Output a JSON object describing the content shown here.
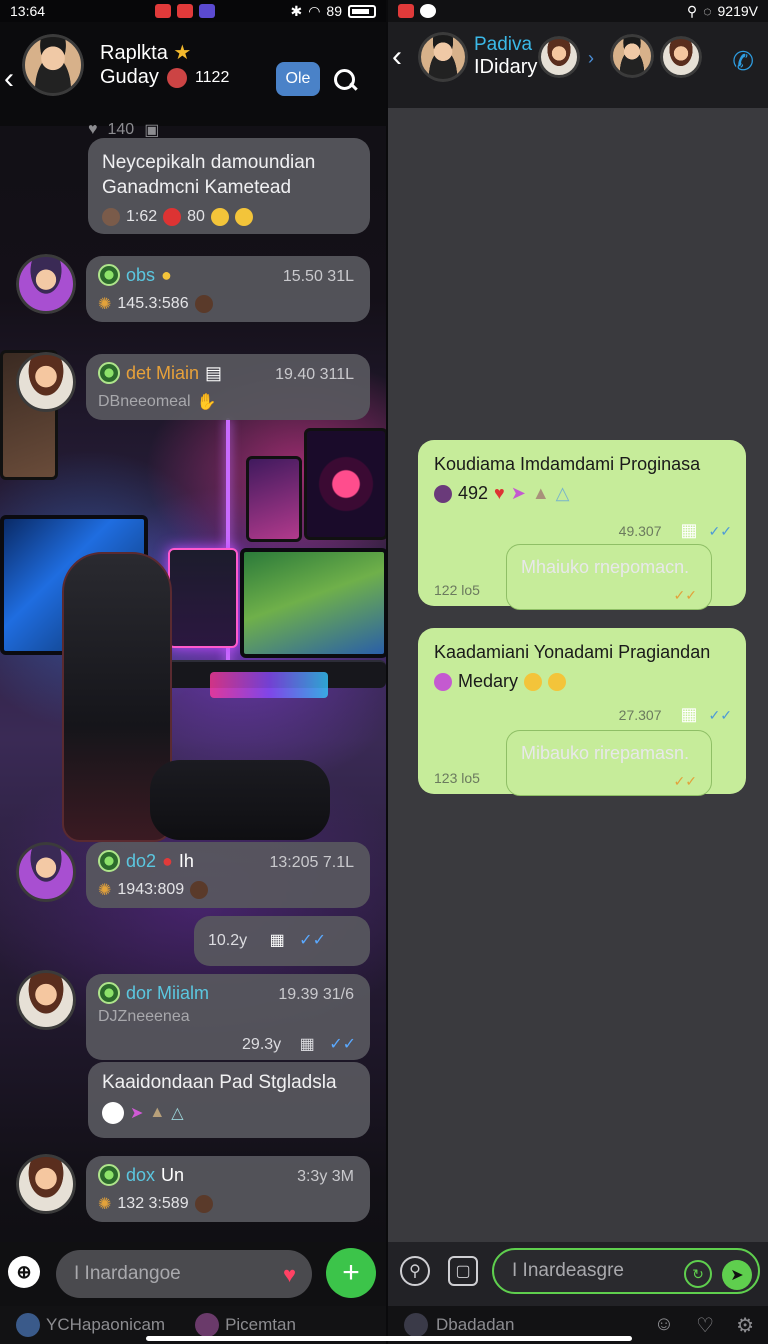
{
  "left": {
    "status": {
      "time": "13:64",
      "battery": "89"
    },
    "header": {
      "title": "Raplkta",
      "subtitle": "Guday",
      "sub_count": "1122",
      "mini_count": "140",
      "pill_label": "Ole"
    },
    "messages": [
      {
        "id": "m1",
        "text_line1": "Neycepikaln damoundian",
        "text_line2": "Ganadmcni Kametead",
        "meta": "1:62",
        "meta2": "80"
      },
      {
        "id": "m2",
        "sender": "obs",
        "time": "15.50 31L",
        "meta": "145.3:586"
      },
      {
        "id": "m3",
        "sender": "det Miain",
        "time": "19.40 311L",
        "text": "DBneeomeal"
      },
      {
        "id": "m4",
        "sender": "do2",
        "sender_suffix": "Ih",
        "time": "13:205 7.1L",
        "meta": "1943:809"
      },
      {
        "id": "m5",
        "time": "10.2y"
      },
      {
        "id": "m6",
        "sender": "dor Miialm",
        "time": "19.39 31/6",
        "text": "DJZneeenea",
        "time2": "29.3y"
      },
      {
        "id": "m7",
        "text": "Kaaidondaan Pad Stgladsla"
      },
      {
        "id": "m8",
        "sender": "dox",
        "sender_suffix": "Un",
        "time": "3:3y 3M",
        "meta": "132 3:589"
      }
    ],
    "composer": {
      "placeholder": "I Inardangoe"
    },
    "bottom": {
      "label1": "YCHapaonicam",
      "label2": "Picemtan"
    }
  },
  "right": {
    "status": {
      "time": "9219V"
    },
    "header": {
      "title": "Padiva",
      "subtitle": "IDidary"
    },
    "messages": [
      {
        "id": "r1",
        "text": "Koudiama Imdamdami Proginasa",
        "meta": "492",
        "time": "49.307"
      },
      {
        "id": "r2",
        "text": "Mhaiuko rnepomacn.",
        "time": "122 lo5"
      },
      {
        "id": "r3",
        "text": "Kaadamiani Yonadami Pragiandan",
        "meta": "Medary",
        "time": "27.307"
      },
      {
        "id": "r4",
        "text": "Mibauko rirepamasn.",
        "time": "123 lo5"
      }
    ],
    "composer": {
      "placeholder": "I Inardeasgre"
    },
    "bottom": {
      "label1": "Dbadadan"
    }
  },
  "colors": {
    "accent_green": "#5fcf4e",
    "bubble_green": "#c6ec9a",
    "link_blue": "#3bb9e8"
  }
}
